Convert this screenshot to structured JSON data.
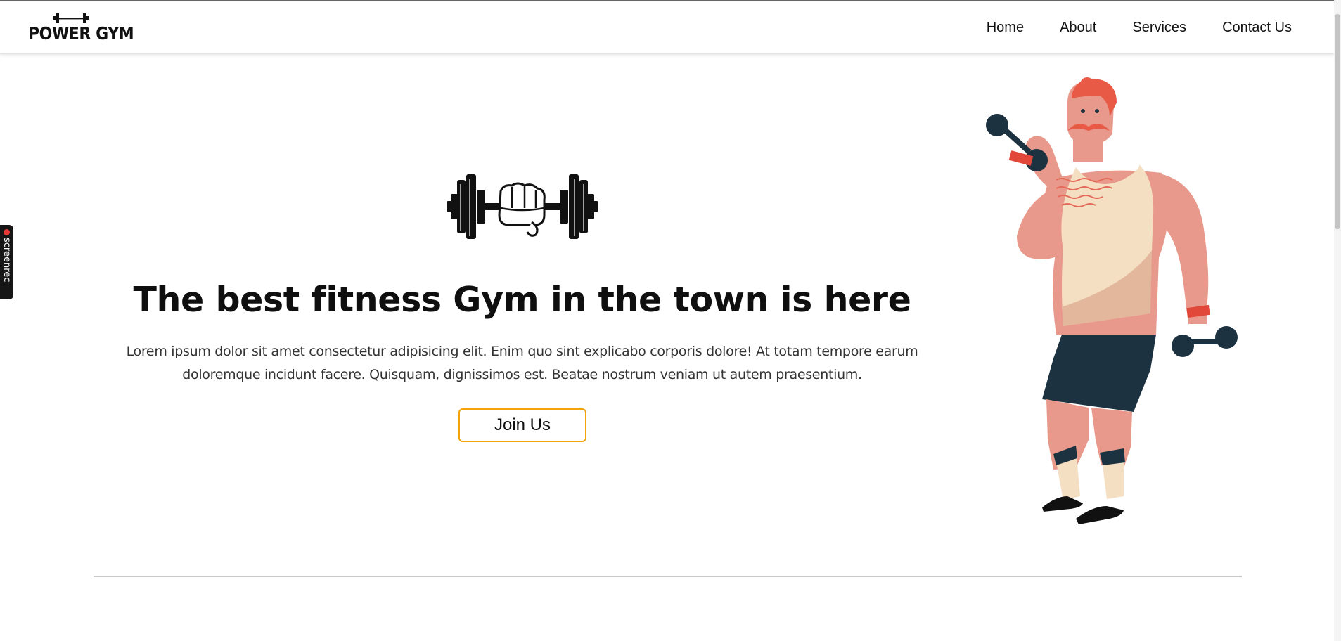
{
  "brand": {
    "name": "POWER GYM"
  },
  "nav": {
    "items": [
      {
        "label": "Home"
      },
      {
        "label": "About"
      },
      {
        "label": "Services"
      },
      {
        "label": "Contact Us"
      }
    ]
  },
  "screenrec": {
    "label": "screenrec"
  },
  "hero": {
    "title": "The best fitness Gym in the town is here",
    "description": "Lorem ipsum dolor sit amet consectetur adipisicing elit. Enim quo sint explicabo corporis dolore! At totam tempore earum doloremque incidunt facere. Quisquam, dignissimos est. Beatae nostrum veniam ut autem praesentium.",
    "cta_label": "Join Us"
  },
  "colors": {
    "accent": "#f3a30b",
    "skin": "#e8998b",
    "tank_top": "#f4dfc3",
    "shorts": "#1d3240",
    "hair": "#e85a45"
  },
  "icons": {
    "brand_mark": "dumbbell-icon",
    "hero_logo": "fist-dumbbell-icon",
    "illustration": "muscle-man-illustration"
  }
}
